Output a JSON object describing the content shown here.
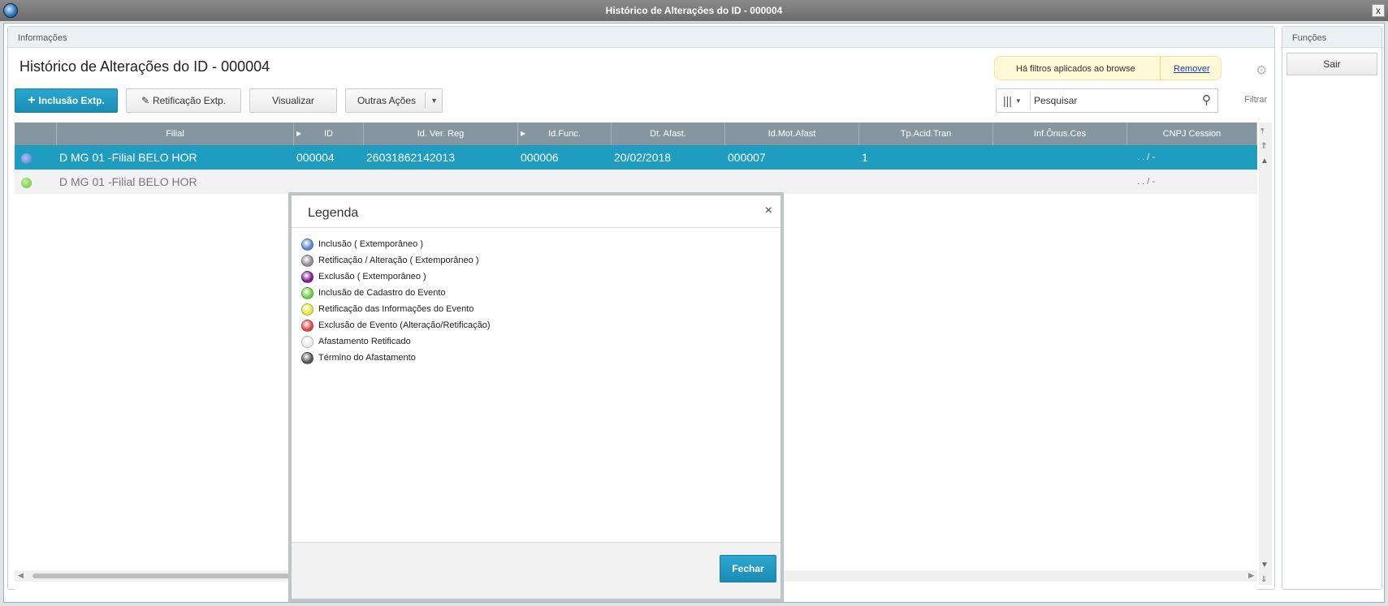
{
  "window": {
    "title": "Histórico de Alterações do ID - 000004",
    "close": "x"
  },
  "main_panel": {
    "header": "Informações",
    "page_title": "Histórico de Alterações do ID - 000004",
    "filter_notice": "Há filtros aplicados ao browse",
    "filter_remove": "Remover",
    "toolbar": {
      "include_label": "Inclusão Extp.",
      "retif_label": "Retificação Extp.",
      "visualizar_label": "Visualizar",
      "outras_label": "Outras Ações"
    },
    "search": {
      "placeholder": "Pesquisar"
    },
    "filtrar_label": "Filtrar"
  },
  "grid": {
    "columns": [
      "",
      "Filial",
      "ID",
      "Id. Ver. Reg",
      "Id.Func.",
      "Dt. Afast.",
      "Id.Mot.Afast",
      "Tp.Acid.Tran",
      "Inf.Ônus.Ces",
      "CNPJ Cession"
    ],
    "rows": [
      {
        "status_color": "#4a7cc9",
        "filial": "D MG 01 -Filial BELO HOR",
        "id": "000004",
        "ver_reg": "26031862142013",
        "func": "000006",
        "dt_afast": "20/02/2018",
        "mot_afast": "000007",
        "tp_acid": "1",
        "onus": "",
        "cnpj": ". .  /  -"
      },
      {
        "status_color": "#6fcf3f",
        "filial": "D MG 01 -Filial BELO HOR",
        "id": "",
        "ver_reg": "",
        "func": "",
        "dt_afast": "",
        "mot_afast": "",
        "tp_acid": "",
        "onus": "",
        "cnpj": ". .  /  -"
      }
    ]
  },
  "functions_panel": {
    "header": "Funções",
    "sair_label": "Sair"
  },
  "modal": {
    "title": "Legenda",
    "close": "×",
    "items": [
      {
        "label": "Inclusão ( Extemporâneo )",
        "color": "#5b87cc"
      },
      {
        "label": "Retificação / Alteração ( Extemporâneo )",
        "color": "#8f8f8f"
      },
      {
        "label": "Exclusão ( Extemporâneo )",
        "color": "#7a1f8a"
      },
      {
        "label": "Inclusão de Cadastro do Evento",
        "color": "#72cc45"
      },
      {
        "label": "Retificação das Informações do Evento",
        "color": "#e5e53a"
      },
      {
        "label": "Exclusão de Evento (Alteração/Retificação)",
        "color": "#e04444"
      },
      {
        "label": "Afastamento Retificado",
        "color": "#ececec"
      },
      {
        "label": "Término do Afastamento",
        "color": "#555555"
      }
    ],
    "fechar_label": "Fechar"
  }
}
